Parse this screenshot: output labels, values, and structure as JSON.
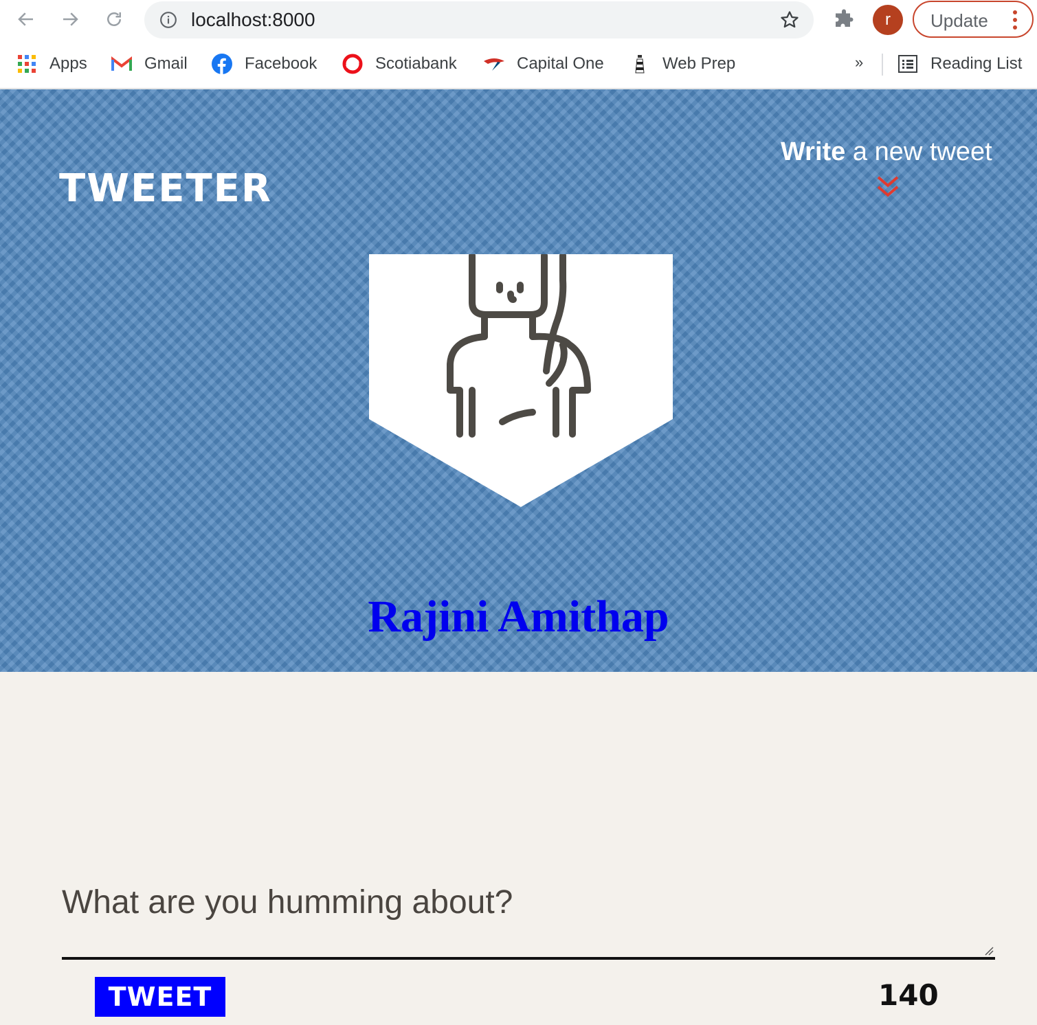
{
  "browser": {
    "url": "localhost:8000",
    "profile_initial": "r",
    "update_label": "Update",
    "bookmarks": [
      {
        "label": "Apps",
        "icon": "apps-grid-icon"
      },
      {
        "label": "Gmail",
        "icon": "gmail-icon"
      },
      {
        "label": "Facebook",
        "icon": "facebook-icon"
      },
      {
        "label": "Scotiabank",
        "icon": "scotiabank-icon"
      },
      {
        "label": "Capital One",
        "icon": "capital-one-icon"
      },
      {
        "label": "Web Prep",
        "icon": "lighthouse-icon"
      }
    ],
    "more_label": "»",
    "reading_list_label": "Reading List"
  },
  "header": {
    "logo": "TWEETER",
    "write_bold": "Write",
    "write_rest": " a new tweet",
    "accent_color": "#e03a2f",
    "user_name": "Rajini Amithap"
  },
  "composer": {
    "placeholder": "What are you humming about?",
    "button_label": "TWEET",
    "counter": "140"
  }
}
